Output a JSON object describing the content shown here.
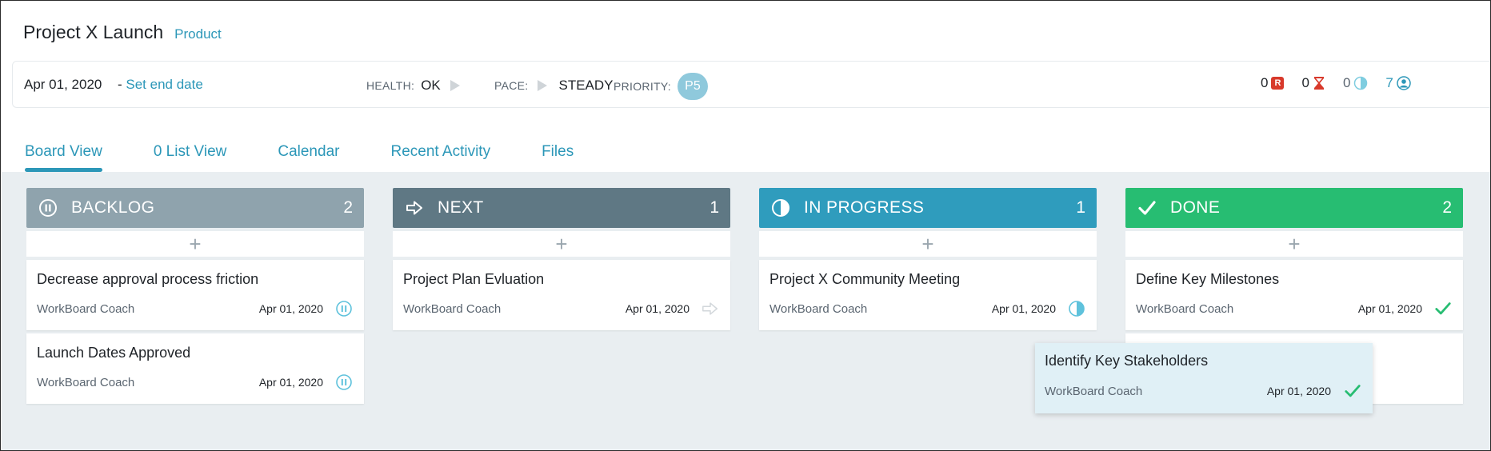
{
  "project": {
    "title": "Project X Launch",
    "category": "Product"
  },
  "info": {
    "start_date": "Apr 01, 2020",
    "end_date_prefix": "- ",
    "end_date_link": "Set end date",
    "health_label": "HEALTH:",
    "health_value": "OK",
    "pace_label": "PACE:",
    "pace_value": "STEADY",
    "priority_label": "PRIORITY:",
    "priority_value": "P5",
    "counters": [
      {
        "value": "0",
        "icon": "red-r-icon"
      },
      {
        "value": "0",
        "icon": "hourglass-icon"
      },
      {
        "value": "0",
        "icon": "half-circle-icon"
      },
      {
        "value": "7",
        "icon": "person-icon"
      }
    ]
  },
  "tabs": [
    {
      "label": "Board View",
      "active": true
    },
    {
      "label": "0 List View",
      "active": false
    },
    {
      "label": "Calendar",
      "active": false
    },
    {
      "label": "Recent Activity",
      "active": false
    },
    {
      "label": "Files",
      "active": false
    }
  ],
  "colors": {
    "backlog": "#8fa3ad",
    "next": "#5f7884",
    "in_progress": "#2f9cbd",
    "done": "#27bd72",
    "accent": "#2c97b8"
  },
  "columns": [
    {
      "title": "BACKLOG",
      "count": "2",
      "icon": "pause-circle-icon",
      "add": "+",
      "cards": [
        {
          "title": "Decrease approval process friction",
          "owner": "WorkBoard Coach",
          "date": "Apr 01, 2020",
          "status_icon": "pause-circle-icon"
        },
        {
          "title": "Launch Dates Approved",
          "owner": "WorkBoard Coach",
          "date": "Apr 01, 2020",
          "status_icon": "pause-circle-icon"
        }
      ]
    },
    {
      "title": "NEXT",
      "count": "1",
      "icon": "arrow-right-icon",
      "add": "+",
      "cards": [
        {
          "title": "Project Plan Evluation",
          "owner": "WorkBoard Coach",
          "date": "Apr 01, 2020",
          "status_icon": "arrow-right-icon"
        }
      ]
    },
    {
      "title": "IN PROGRESS",
      "count": "1",
      "icon": "half-circle-icon",
      "add": "+",
      "cards": [
        {
          "title": "Project X Community Meeting",
          "owner": "WorkBoard Coach",
          "date": "Apr 01, 2020",
          "status_icon": "half-circle-icon"
        }
      ]
    },
    {
      "title": "DONE",
      "count": "2",
      "icon": "checkmark-icon",
      "add": "+",
      "cards": [
        {
          "title": "Define Key Milestones",
          "owner": "WorkBoard Coach",
          "date": "Apr 01, 2020",
          "status_icon": "checkmark-icon"
        }
      ]
    }
  ],
  "dragging_card": {
    "title": "Identify Key Stakeholders",
    "owner": "WorkBoard Coach",
    "date": "Apr 01, 2020",
    "status_icon": "checkmark-icon"
  }
}
